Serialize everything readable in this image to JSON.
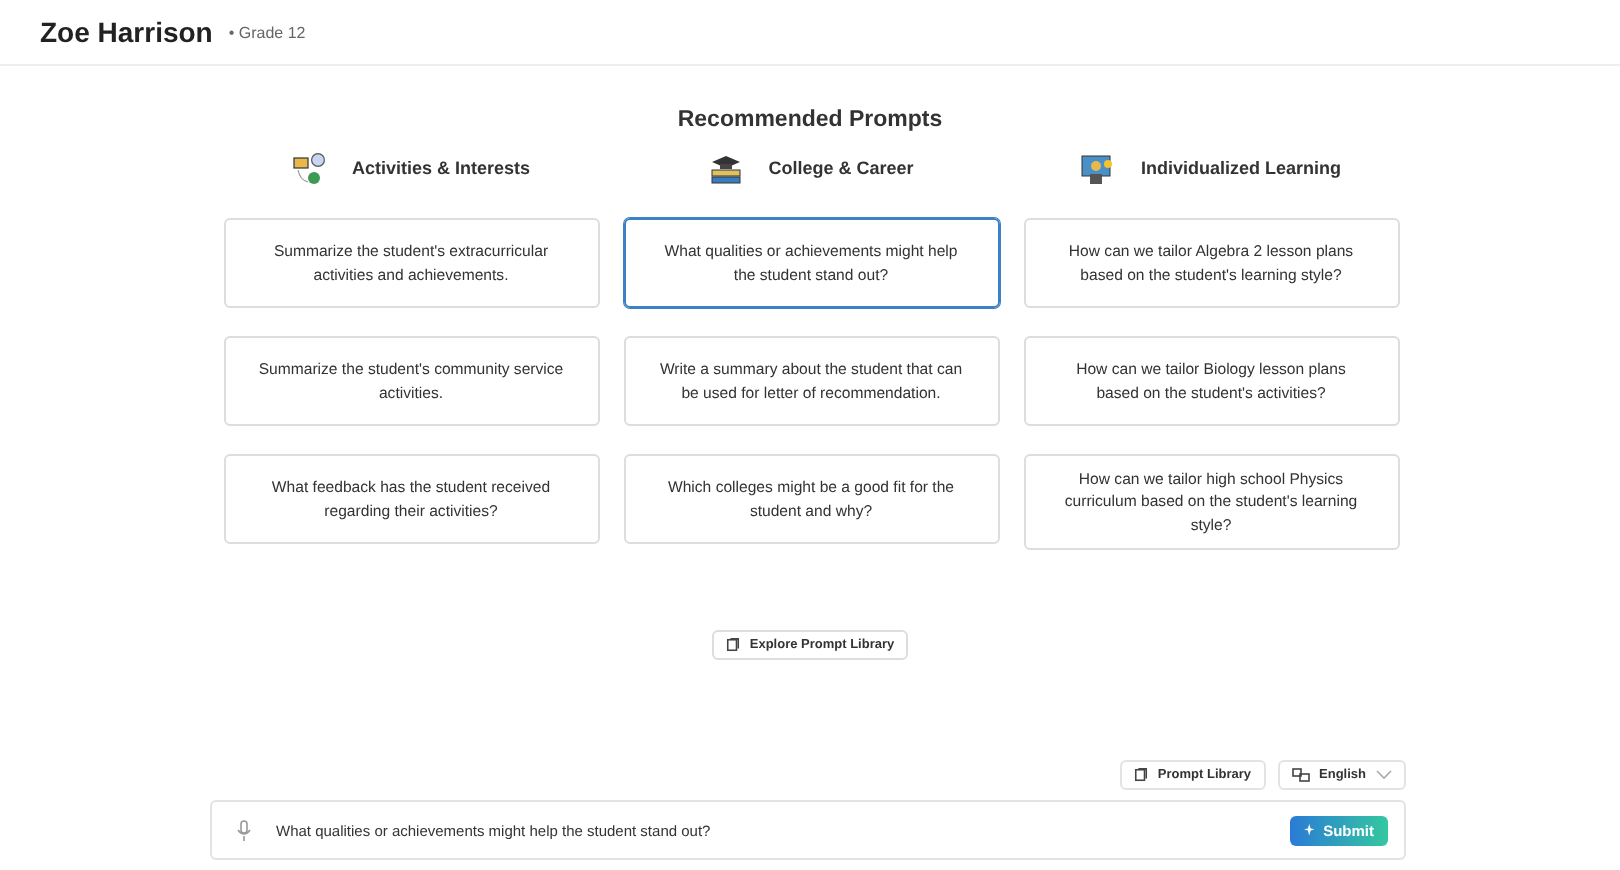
{
  "student": {
    "name": "Zoe Harrison",
    "grade": "• Grade 12"
  },
  "section_title": "Recommended Prompts",
  "columns": [
    {
      "kind": "activities",
      "title": "Activities & Interests",
      "prompts": [
        {
          "text": "Summarize the student's extracurricular activities and achievements.",
          "selected": false
        },
        {
          "text": "Summarize the student's community service activities.",
          "selected": false
        },
        {
          "text": "What feedback has the student received regarding their activities?",
          "selected": false
        }
      ]
    },
    {
      "kind": "college",
      "title": "College & Career",
      "prompts": [
        {
          "text": "What qualities or achievements might help the student stand out?",
          "selected": true
        },
        {
          "text": "Write a summary about the student that can be used for letter of recommendation.",
          "selected": false
        },
        {
          "text": "Which colleges might be a good fit for the student and why?",
          "selected": false
        }
      ]
    },
    {
      "kind": "learning",
      "title": "Individualized Learning",
      "prompts": [
        {
          "text": "How can we tailor Algebra 2 lesson plans based on the student's learning style?",
          "selected": false
        },
        {
          "text": "How can we tailor Biology lesson plans based on the student's activities?",
          "selected": false
        },
        {
          "text": "How can we tailor high school Physics curriculum based on the student's learning style?",
          "selected": false
        }
      ]
    }
  ],
  "explore_button": "Explore Prompt Library",
  "prompt_library_button": "Prompt Library",
  "language": "English",
  "input": {
    "value": "What qualities or achievements might help the student stand out?"
  },
  "submit_button": "Submit"
}
